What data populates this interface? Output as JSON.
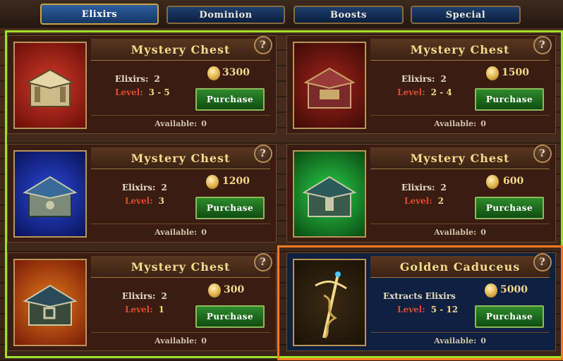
{
  "tabs": [
    {
      "label": "Elixirs",
      "active": true
    },
    {
      "label": "Dominion",
      "active": false
    },
    {
      "label": "Boosts",
      "active": false
    },
    {
      "label": "Special",
      "active": false
    }
  ],
  "cards": [
    {
      "title": "Mystery Chest",
      "elixirs_label": "Elixirs:",
      "elixirs": "2",
      "level_label": "Level:",
      "level": "3 - 5",
      "price": "3300",
      "button": "Purchase",
      "available_label": "Available:",
      "available": "0",
      "help": "?",
      "image": "red-chest-icon"
    },
    {
      "title": "Mystery Chest",
      "elixirs_label": "Elixirs:",
      "elixirs": "2",
      "level_label": "Level:",
      "level": "2 - 4",
      "price": "1500",
      "button": "Purchase",
      "available_label": "Available:",
      "available": "0",
      "help": "?",
      "image": "dark-red-chest-icon"
    },
    {
      "title": "Mystery Chest",
      "elixirs_label": "Elixirs:",
      "elixirs": "2",
      "level_label": "Level:",
      "level": "3",
      "price": "1200",
      "button": "Purchase",
      "available_label": "Available:",
      "available": "0",
      "help": "?",
      "image": "blue-chest-icon"
    },
    {
      "title": "Mystery Chest",
      "elixirs_label": "Elixirs:",
      "elixirs": "2",
      "level_label": "Level:",
      "level": "2",
      "price": "600",
      "button": "Purchase",
      "available_label": "Available:",
      "available": "0",
      "help": "?",
      "image": "green-chest-icon"
    },
    {
      "title": "Mystery Chest",
      "elixirs_label": "Elixirs:",
      "elixirs": "2",
      "level_label": "Level:",
      "level": "1",
      "price": "300",
      "button": "Purchase",
      "available_label": "Available:",
      "available": "0",
      "help": "?",
      "image": "orange-chest-icon"
    },
    {
      "title": "Golden Caduceus",
      "elixirs_label": "Extracts Elixirs",
      "elixirs": "",
      "level_label": "Level:",
      "level": "5 - 12",
      "price": "5000",
      "button": "Purchase",
      "available_label": "Available:",
      "available": "0",
      "help": "?",
      "image": "golden-caduceus-icon"
    }
  ],
  "colors": {
    "accent_gold": "#f3d98b",
    "level_red": "#e04a2a",
    "purchase_green": "#2e8a2c",
    "highlight_green": "#9fe02a",
    "highlight_orange": "#ff7a24"
  }
}
